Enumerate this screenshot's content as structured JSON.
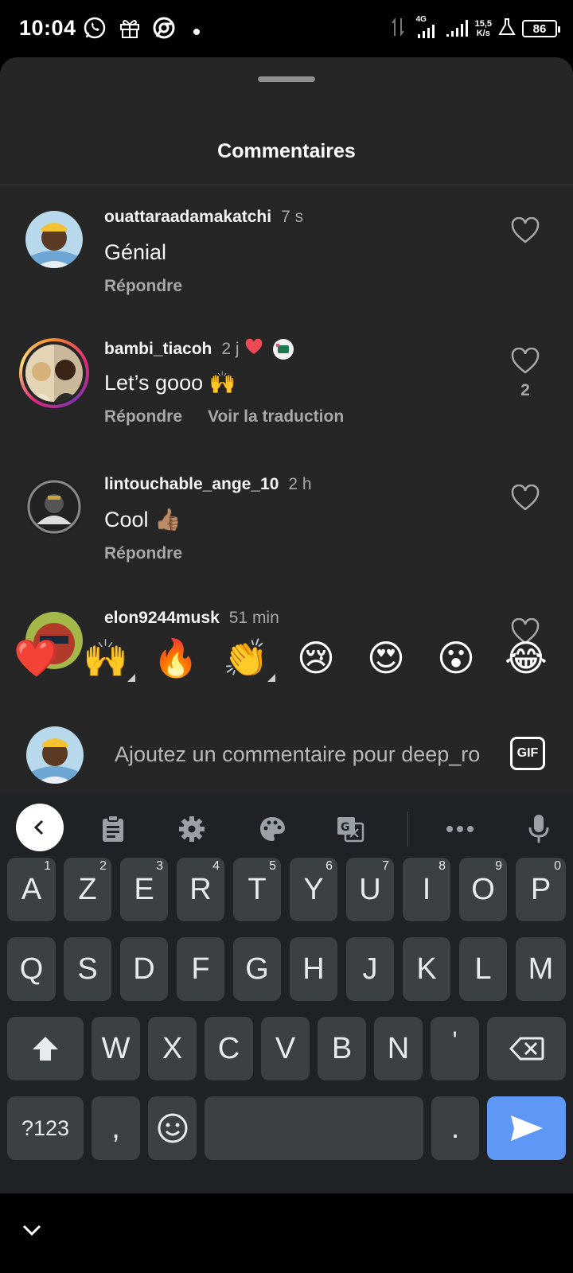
{
  "status_bar": {
    "time": "10:04",
    "network": "4G",
    "speed_value": "15,5",
    "speed_unit": "K/s",
    "battery": "86"
  },
  "sheet": {
    "title": "Commentaires"
  },
  "comments": [
    {
      "username": "ouattaraadamakatchi",
      "time": "7 s",
      "text": "Génial",
      "reply_label": "Répondre",
      "translate_label": "",
      "like_count": ""
    },
    {
      "username": "bambi_tiacoh",
      "time": "2 j",
      "text": "Let’s gooo 🙌",
      "reply_label": "Répondre",
      "translate_label": "Voir la traduction",
      "like_count": "2"
    },
    {
      "username": "lintouchable_ange_10",
      "time": "2 h",
      "text": "Cool 👍🏽",
      "reply_label": "Répondre",
      "translate_label": "",
      "like_count": ""
    },
    {
      "username": "elon9244musk",
      "time": "51 min",
      "text": "",
      "reply_label": "",
      "translate_label": "",
      "like_count": ""
    }
  ],
  "emoji_bar": [
    "❤️",
    "🙌",
    "🔥",
    "👏",
    "😢",
    "😍",
    "😮",
    "😂"
  ],
  "comment_input": {
    "placeholder": "Ajoutez un commentaire pour deep_ro",
    "gif_label": "GIF"
  },
  "keyboard": {
    "row1": [
      {
        "label": "A",
        "hint": "1"
      },
      {
        "label": "Z",
        "hint": "2"
      },
      {
        "label": "E",
        "hint": "3"
      },
      {
        "label": "R",
        "hint": "4"
      },
      {
        "label": "T",
        "hint": "5"
      },
      {
        "label": "Y",
        "hint": "6"
      },
      {
        "label": "U",
        "hint": "7"
      },
      {
        "label": "I",
        "hint": "8"
      },
      {
        "label": "O",
        "hint": "9"
      },
      {
        "label": "P",
        "hint": "0"
      }
    ],
    "row2": [
      "Q",
      "S",
      "D",
      "F",
      "G",
      "H",
      "J",
      "K",
      "L",
      "M"
    ],
    "row3": [
      "W",
      "X",
      "C",
      "V",
      "B",
      "N",
      "'"
    ],
    "symbols_label": "?123",
    "comma_label": ",",
    "period_label": "."
  },
  "colors": {
    "sheet_bg": "#262626",
    "keyboard_bg": "#202124",
    "key_bg": "#3c4043",
    "send_key": "#5e97f6",
    "like_heart": "#ed4956"
  }
}
